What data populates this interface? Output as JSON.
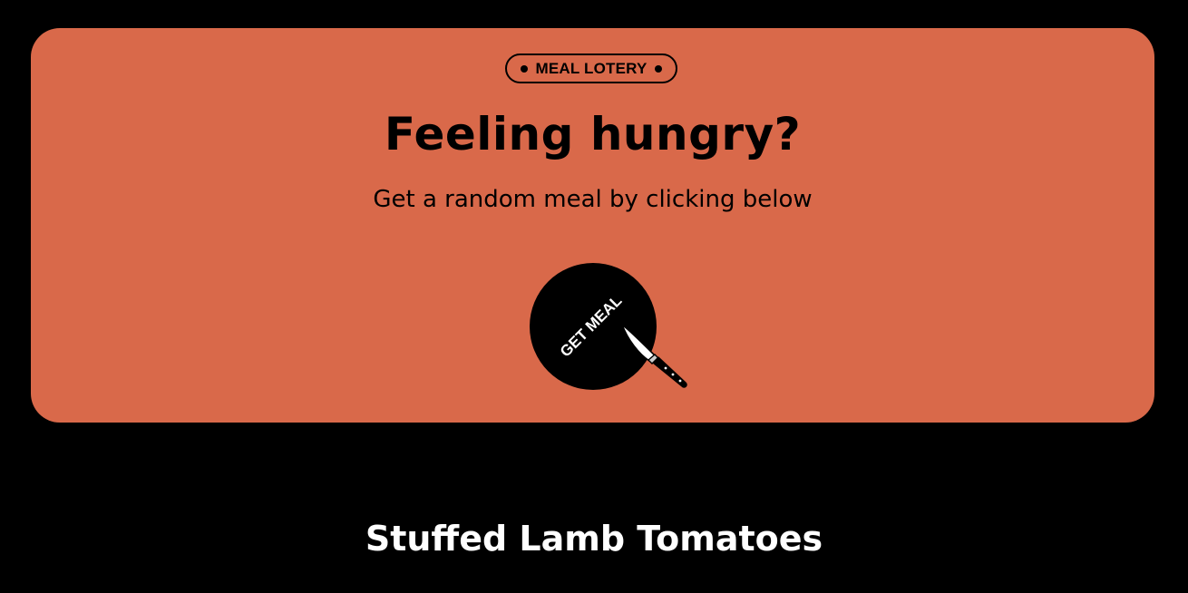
{
  "theme": {
    "accent": "#d9694a",
    "background": "#000000",
    "text_dark": "#000000",
    "text_light": "#ffffff"
  },
  "hero": {
    "badge_label": "MEAL LOTERY",
    "headline": "Feeling hungry?",
    "subline": "Get a random meal by clicking below",
    "button_label": "GET MEAL",
    "button_icon": "knife-icon"
  },
  "result": {
    "meal_title": "Stuffed Lamb Tomatoes"
  }
}
